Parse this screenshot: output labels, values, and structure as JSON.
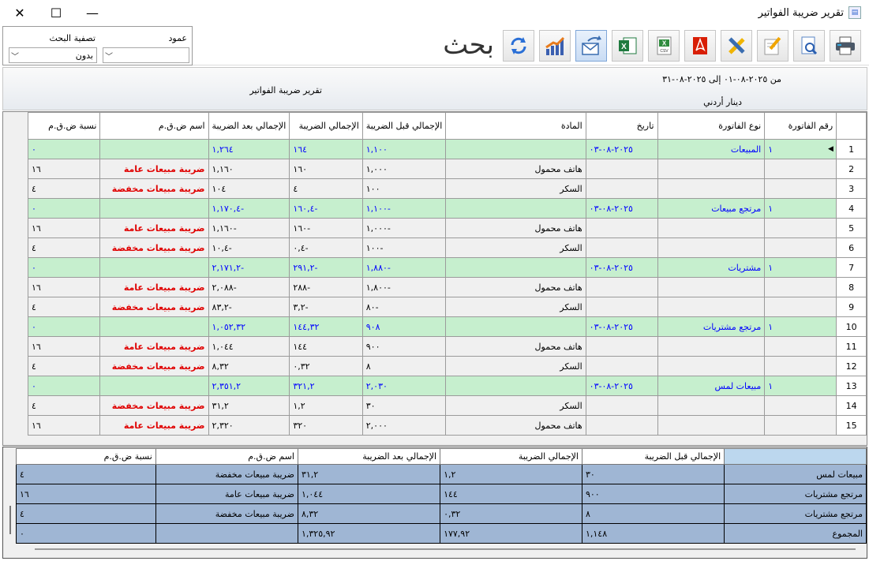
{
  "window": {
    "title": "تقرير ضريبة الفواتير",
    "close_glyph": "✕",
    "maximize_glyph": "☐",
    "minimize_glyph": "—"
  },
  "toolbar": {
    "search_label": "بحث",
    "buttons": [
      "print-icon",
      "preview-icon",
      "edit-icon",
      "design-icon",
      "pdf-icon",
      "csv-icon",
      "excel-icon",
      "email-icon",
      "chart-icon",
      "refresh-icon"
    ]
  },
  "filter": {
    "column_label": "عمود",
    "column_value": "",
    "search_filter_label": "تصفية البحث",
    "search_filter_value": "بدون"
  },
  "report_header": {
    "date_range": "من ٢٠٢٥-٠٨-٠١ إلى ٢٠٢٥-٠٨-٣١",
    "title": "تقرير ضريبة الفواتير",
    "currency": "دينار أردني"
  },
  "grid": {
    "columns": [
      "رقم الفاتورة",
      "نوع الفاتورة",
      "تاريخ",
      "المادة",
      "الإجمالي قبل الضريبة",
      "الإجمالي الضريبة",
      "الإجمالي بعد الضريبة",
      "اسم ض.ق.م",
      "نسبة ض.ق.م"
    ],
    "rows": [
      {
        "n": "1",
        "g": true,
        "invoice": "١",
        "type": "المبيعات",
        "date": "٢٠٢٥-٠٨-٠٣",
        "item": "",
        "before": "١,١٠٠",
        "tax": "١٦٤",
        "after": "١,٢٦٤",
        "tax_name": "",
        "rate": "٠"
      },
      {
        "n": "2",
        "g": false,
        "invoice": "",
        "type": "",
        "date": "",
        "item": "هاتف محمول",
        "before": "١,٠٠٠",
        "tax": "١٦٠",
        "after": "١,١٦٠",
        "tax_name": "ضريبة مبيعات عامة",
        "rate": "١٦"
      },
      {
        "n": "3",
        "g": false,
        "invoice": "",
        "type": "",
        "date": "",
        "item": "السكر",
        "before": "١٠٠",
        "tax": "٤",
        "after": "١٠٤",
        "tax_name": "ضريبة مبيعات مخفضة",
        "rate": "٤"
      },
      {
        "n": "4",
        "g": true,
        "invoice": "١",
        "type": "مرتجع مبيعات",
        "date": "٢٠٢٥-٠٨-٠٣",
        "item": "",
        "before": "-١,١٠٠",
        "tax": "-١٦٠,٤",
        "after": "-١,١٧٠,٤",
        "tax_name": "",
        "rate": "٠"
      },
      {
        "n": "5",
        "g": false,
        "invoice": "",
        "type": "",
        "date": "",
        "item": "هاتف محمول",
        "before": "-١,٠٠٠",
        "tax": "-١٦٠",
        "after": "-١,١٦٠",
        "tax_name": "ضريبة مبيعات عامة",
        "rate": "١٦"
      },
      {
        "n": "6",
        "g": false,
        "invoice": "",
        "type": "",
        "date": "",
        "item": "السكر",
        "before": "-١٠٠",
        "tax": "-٠,٤",
        "after": "-١٠,٤",
        "tax_name": "ضريبة مبيعات مخفضة",
        "rate": "٤"
      },
      {
        "n": "7",
        "g": true,
        "invoice": "١",
        "type": "مشتريات",
        "date": "٢٠٢٥-٠٨-٠٣",
        "item": "",
        "before": "-١,٨٨٠",
        "tax": "-٢٩١,٢",
        "after": "-٢,١٧١,٢",
        "tax_name": "",
        "rate": "٠"
      },
      {
        "n": "8",
        "g": false,
        "invoice": "",
        "type": "",
        "date": "",
        "item": "هاتف محمول",
        "before": "-١,٨٠٠",
        "tax": "-٢٨٨",
        "after": "-٢,٠٨٨",
        "tax_name": "ضريبة مبيعات عامة",
        "rate": "١٦"
      },
      {
        "n": "9",
        "g": false,
        "invoice": "",
        "type": "",
        "date": "",
        "item": "السكر",
        "before": "-٨٠",
        "tax": "-٣,٢",
        "after": "-٨٣,٢",
        "tax_name": "ضريبة مبيعات مخفضة",
        "rate": "٤"
      },
      {
        "n": "10",
        "g": true,
        "invoice": "١",
        "type": "مرتجع مشتريات",
        "date": "٢٠٢٥-٠٨-٠٣",
        "item": "",
        "before": "٩٠٨",
        "tax": "١٤٤,٣٢",
        "after": "١,٠٥٢,٣٢",
        "tax_name": "",
        "rate": "٠"
      },
      {
        "n": "11",
        "g": false,
        "invoice": "",
        "type": "",
        "date": "",
        "item": "هاتف محمول",
        "before": "٩٠٠",
        "tax": "١٤٤",
        "after": "١,٠٤٤",
        "tax_name": "ضريبة مبيعات عامة",
        "rate": "١٦"
      },
      {
        "n": "12",
        "g": false,
        "invoice": "",
        "type": "",
        "date": "",
        "item": "السكر",
        "before": "٨",
        "tax": "٠,٣٢",
        "after": "٨,٣٢",
        "tax_name": "ضريبة مبيعات مخفضة",
        "rate": "٤"
      },
      {
        "n": "13",
        "g": true,
        "invoice": "١",
        "type": "مبيعات لمس",
        "date": "٢٠٢٥-٠٨-٠٣",
        "item": "",
        "before": "٢,٠٣٠",
        "tax": "٣٢١,٢",
        "after": "٢,٣٥١,٢",
        "tax_name": "",
        "rate": "٠"
      },
      {
        "n": "14",
        "g": false,
        "invoice": "",
        "type": "",
        "date": "",
        "item": "السكر",
        "before": "٣٠",
        "tax": "١,٢",
        "after": "٣١,٢",
        "tax_name": "ضريبة مبيعات مخفضة",
        "rate": "٤"
      },
      {
        "n": "15",
        "g": false,
        "invoice": "",
        "type": "",
        "date": "",
        "item": "هاتف محمول",
        "before": "٢,٠٠٠",
        "tax": "٣٢٠",
        "after": "٢,٣٢٠",
        "tax_name": "ضريبة مبيعات عامة",
        "rate": "١٦"
      }
    ]
  },
  "summary": {
    "columns": [
      "",
      "الإجمالي قبل الضريبة",
      "الإجمالي الضريبة",
      "الإجمالي بعد الضريبة",
      "اسم ض.ق.م",
      "نسبة ض.ق.م"
    ],
    "rows": [
      {
        "label": "مبيعات لمس",
        "before": "٣٠",
        "tax": "١,٢",
        "after": "٣١,٢",
        "tax_name": "ضريبة مبيعات مخفضة",
        "rate": "٤"
      },
      {
        "label": "مرتجع مشتريات",
        "before": "٩٠٠",
        "tax": "١٤٤",
        "after": "١,٠٤٤",
        "tax_name": "ضريبة مبيعات عامة",
        "rate": "١٦"
      },
      {
        "label": "مرتجع مشتريات",
        "before": "٨",
        "tax": "٠,٣٢",
        "after": "٨,٣٢",
        "tax_name": "ضريبة مبيعات مخفضة",
        "rate": "٤"
      },
      {
        "label": "المجموع",
        "before": "١,١٤٨",
        "tax": "١٧٧,٩٢",
        "after": "١,٣٢٥,٩٢",
        "tax_name": "",
        "rate": "٠"
      }
    ]
  },
  "colors": {
    "group_row_bg": "#c6efce",
    "group_row_text": "#0000ff",
    "tax_name_red": "#e00000",
    "summary_bg": "#9fb6d4"
  }
}
